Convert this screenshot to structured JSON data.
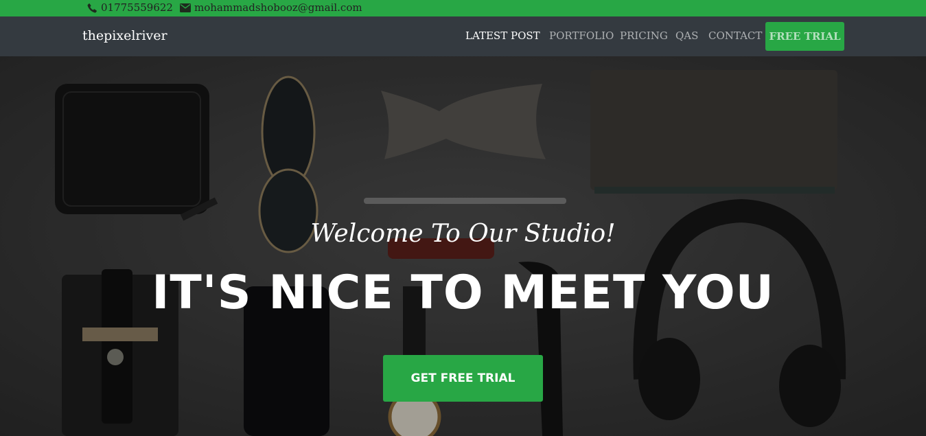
{
  "topbar": {
    "phone": "01775559622",
    "email": "mohammadshobooz@gmail.com",
    "phone_icon": "phone-icon",
    "email_icon": "envelope-icon"
  },
  "navbar": {
    "brand": "thepixelriver",
    "links": [
      "LATEST POST",
      "PORTFOLIO",
      "PRICING",
      "QAS",
      "CONTACT"
    ],
    "cta": "FREE TRIAL"
  },
  "hero": {
    "subtitle": "Welcome To Our Studio!",
    "title": "IT'S NICE TO MEET YOU",
    "cta": "GET FREE TRIAL"
  },
  "colors": {
    "accent": "#28a745",
    "navbar": "#343a40"
  }
}
